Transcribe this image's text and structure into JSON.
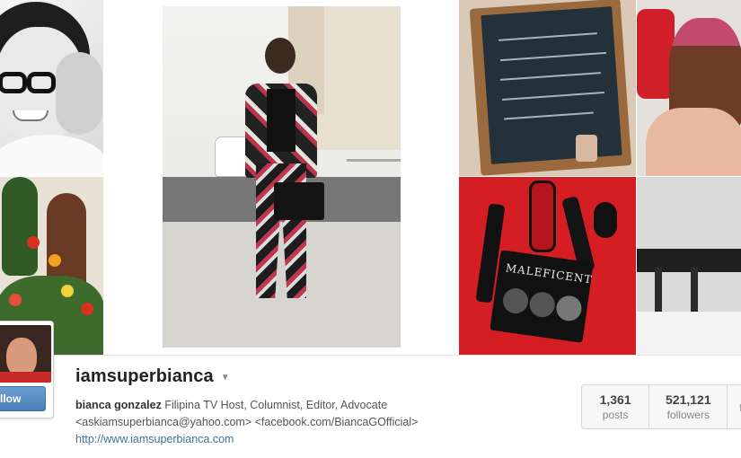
{
  "profile": {
    "username": "iamsuperbianca",
    "full_name": "bianca gonzalez",
    "bio_line1": "Filipina TV Host, Columnist, Editor, Advocate",
    "bio_line2": "<askiamsuperbianca@yahoo.com> <facebook.com/BiancaGOfficial>",
    "website": "http://www.iamsuperbianca.com",
    "follow_label": "llow"
  },
  "stats": [
    {
      "value": "1,361",
      "label": "posts"
    },
    {
      "value": "521,121",
      "label": "followers"
    },
    {
      "value": "",
      "label": "fo"
    }
  ],
  "collage": {
    "makeup_palette_text": "MALEFICENT"
  },
  "icons": {
    "username_menu": "caret-down-icon"
  },
  "colors": {
    "link": "#3f729b",
    "follow_button": "#4a7fb5"
  }
}
